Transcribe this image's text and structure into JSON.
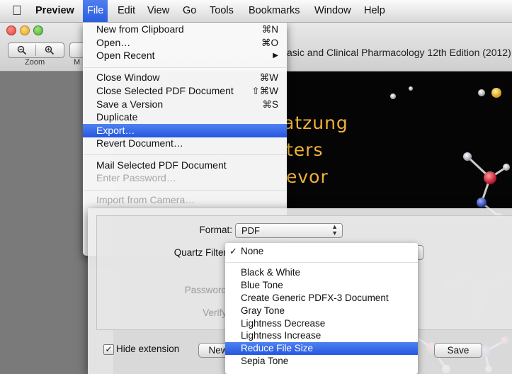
{
  "menubar": {
    "items": [
      "Preview",
      "File",
      "Edit",
      "View",
      "Go",
      "Tools",
      "Bookmarks",
      "Window",
      "Help"
    ]
  },
  "window": {
    "title": "asic and Clinical Pharmacology 12th Edition (2012).",
    "toolbar": {
      "zoom_label": "Zoom",
      "partial_label": "M"
    }
  },
  "file_menu": {
    "items": [
      {
        "label": "New from Clipboard",
        "shortcut": "⌘N"
      },
      {
        "label": "Open…",
        "shortcut": "⌘O"
      },
      {
        "label": "Open Recent",
        "shortcut": "▶"
      },
      {
        "label": "Close Window",
        "shortcut": "⌘W"
      },
      {
        "label": "Close Selected PDF Document",
        "shortcut": "⇧⌘W"
      },
      {
        "label": "Save a Version",
        "shortcut": "⌘S"
      },
      {
        "label": "Duplicate",
        "shortcut": ""
      },
      {
        "label": "Export…",
        "shortcut": ""
      },
      {
        "label": "Revert Document…",
        "shortcut": ""
      },
      {
        "label": "Mail Selected PDF Document",
        "shortcut": ""
      },
      {
        "label": "Enter Password…",
        "shortcut": ""
      },
      {
        "label": "Import from Camera…",
        "shortcut": ""
      }
    ]
  },
  "document": {
    "lines": [
      "atzung",
      "ters",
      "evor"
    ]
  },
  "export_sheet": {
    "format_label": "Format:",
    "format_value": "PDF",
    "quartz_label": "Quartz Filter",
    "password_label": "Password",
    "verify_label": "Verify",
    "hide_extension_label": "Hide extension",
    "new_button": "New",
    "save_button": "Save",
    "quartz_options": [
      {
        "label": "None",
        "checked": "✓"
      },
      {
        "label": "Black & White"
      },
      {
        "label": "Blue Tone"
      },
      {
        "label": "Create Generic PDFX-3 Document"
      },
      {
        "label": "Gray Tone"
      },
      {
        "label": "Lightness Decrease"
      },
      {
        "label": "Lightness Increase"
      },
      {
        "label": "Reduce File Size"
      },
      {
        "label": "Sepia Tone"
      }
    ]
  }
}
